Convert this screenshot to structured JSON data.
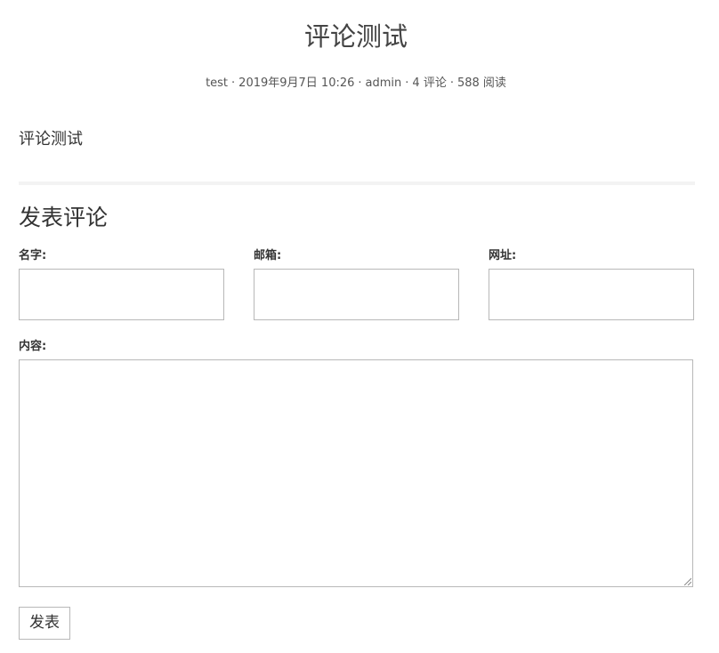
{
  "post": {
    "title": "评论测试",
    "meta": {
      "author": "test",
      "date": "2019年9月7日 10:26",
      "user": "admin",
      "comments": "4 评论",
      "views": "588 阅读",
      "separator": "·"
    },
    "body": "评论测试"
  },
  "comment_form": {
    "heading": "发表评论",
    "name_label": "名字:",
    "email_label": "邮箱:",
    "url_label": "网址:",
    "content_label": "内容:",
    "name_value": "",
    "email_value": "",
    "url_value": "",
    "content_value": "",
    "submit_label": "发表"
  }
}
